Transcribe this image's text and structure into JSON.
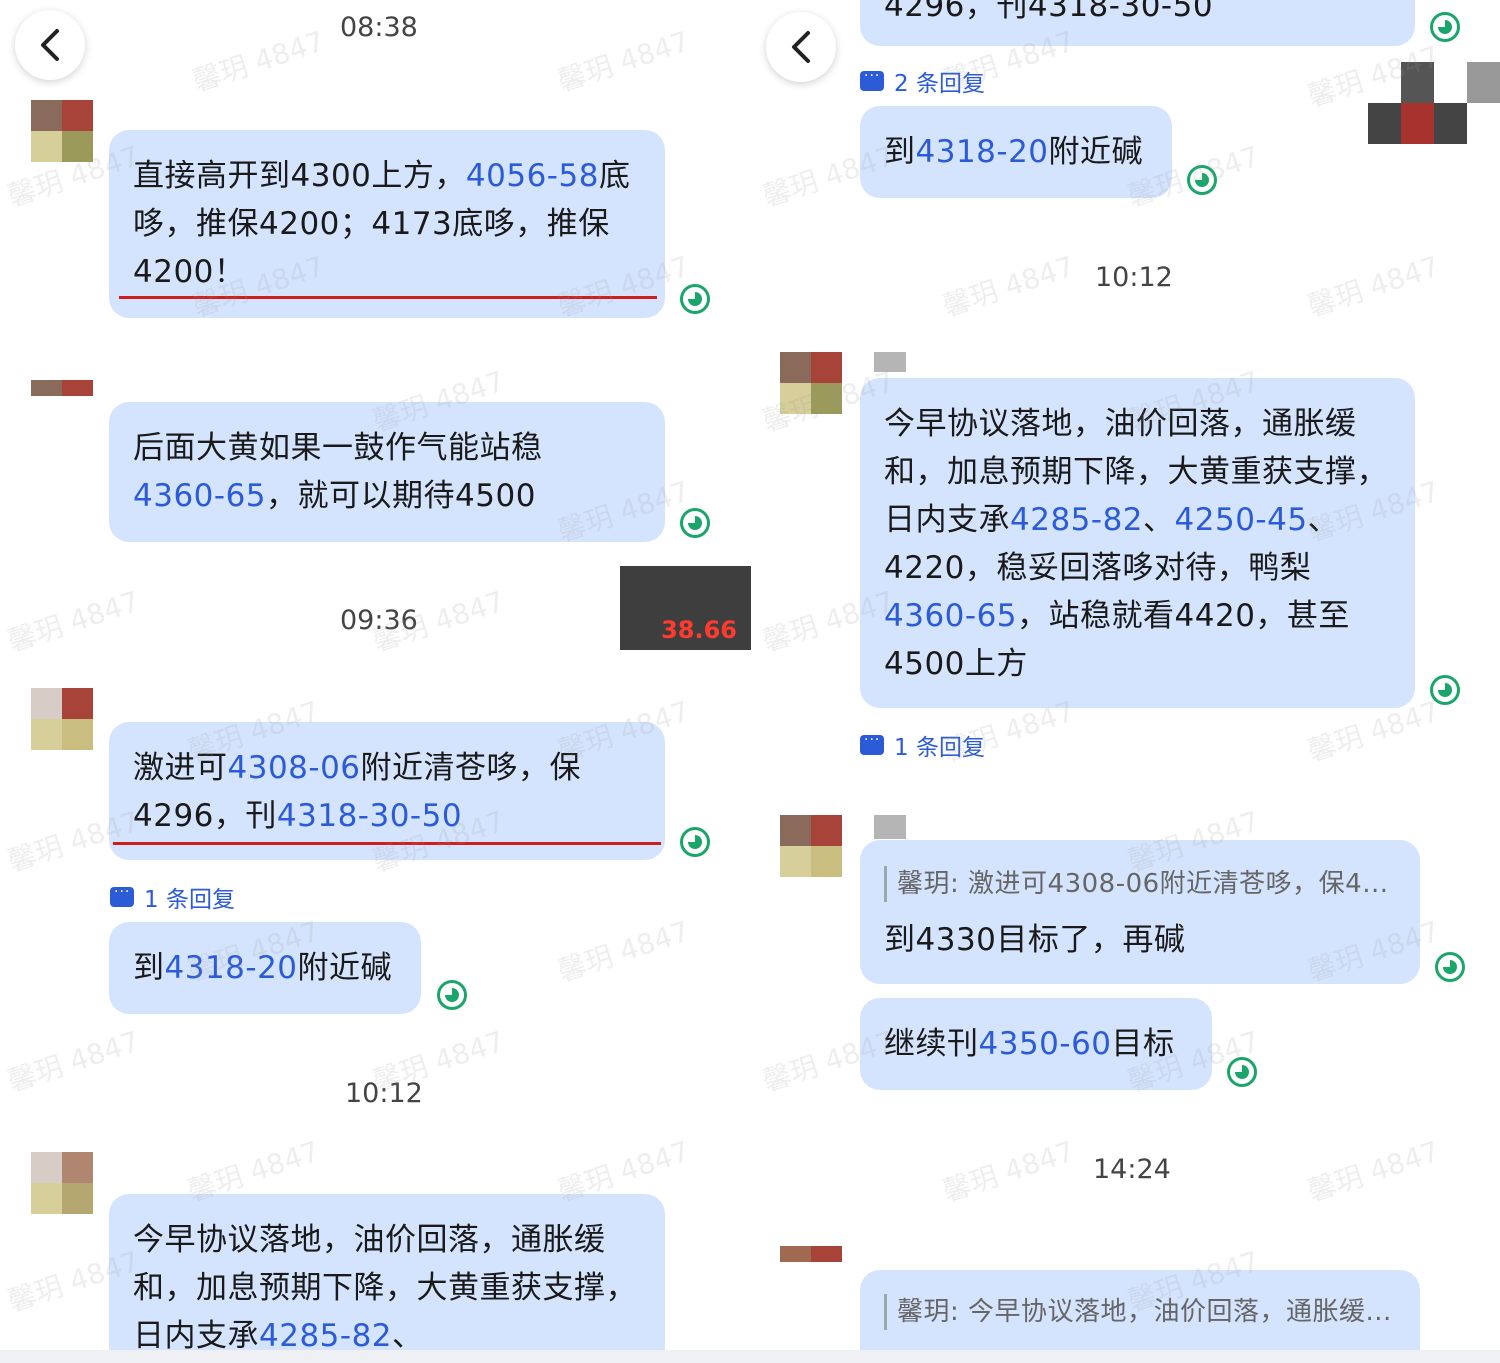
{
  "watermark": "馨玥 4847",
  "left": {
    "times": [
      "08:38",
      "09:36",
      "10:12"
    ],
    "msg1": {
      "a": "直接高开到4300上方，",
      "b": "4056-58",
      "c": "底哆，推保4200；4173底哆，推保4200！"
    },
    "msg2": {
      "a": "后面大黄如果一鼓作气能站稳",
      "b": "4360-65",
      "c": "，就可以期待4500"
    },
    "msg3": {
      "a": "激进可",
      "b": "4308-06",
      "c": "附近清苍哆，保4296，刊",
      "d": "4318-30-50"
    },
    "reply1": "1 条回复",
    "msg4": {
      "a": "到",
      "b": "4318-20",
      "c": "附近碱"
    },
    "msg5": {
      "a": "今早协议落地，油价回落，通胀缓和，加息预期下降，大黄重获支撑，日内支承",
      "b": "4285-82",
      "c": "、"
    },
    "overlay_value": "38.66"
  },
  "right": {
    "top_cut": "4296，刊4318-30-50",
    "reply2": "2 条回复",
    "msg_a": {
      "a": "到",
      "b": "4318-20",
      "c": "附近碱"
    },
    "time1": "10:12",
    "msg_b": {
      "a": "今早协议落地，油价回落，通胀缓和，加息预期下降，大黄重获支撑，日内支承",
      "b": "4285-82",
      "c": "、",
      "d": "4250-45",
      "e": "、4220，稳妥回落哆对待，鸭梨",
      "f": "4360-65",
      "g": "，站稳就看4420，甚至4500上方"
    },
    "reply3": "1 条回复",
    "msg_c": {
      "quote": "馨玥: 激进可4308-06附近清苍哆，保4...",
      "text": "到4330目标了，再碱"
    },
    "msg_d": {
      "a": "继续刊",
      "b": "4350-60",
      "c": "目标"
    },
    "time2": "14:24",
    "msg_e": {
      "quote": "馨玥: 今早协议落地，油价回落，通胀缓..."
    }
  },
  "colors": {
    "bubble": "#d5e4fe",
    "highlight": "#2b5bd7",
    "status": "#1aa66a",
    "underline": "#d01e1e"
  }
}
